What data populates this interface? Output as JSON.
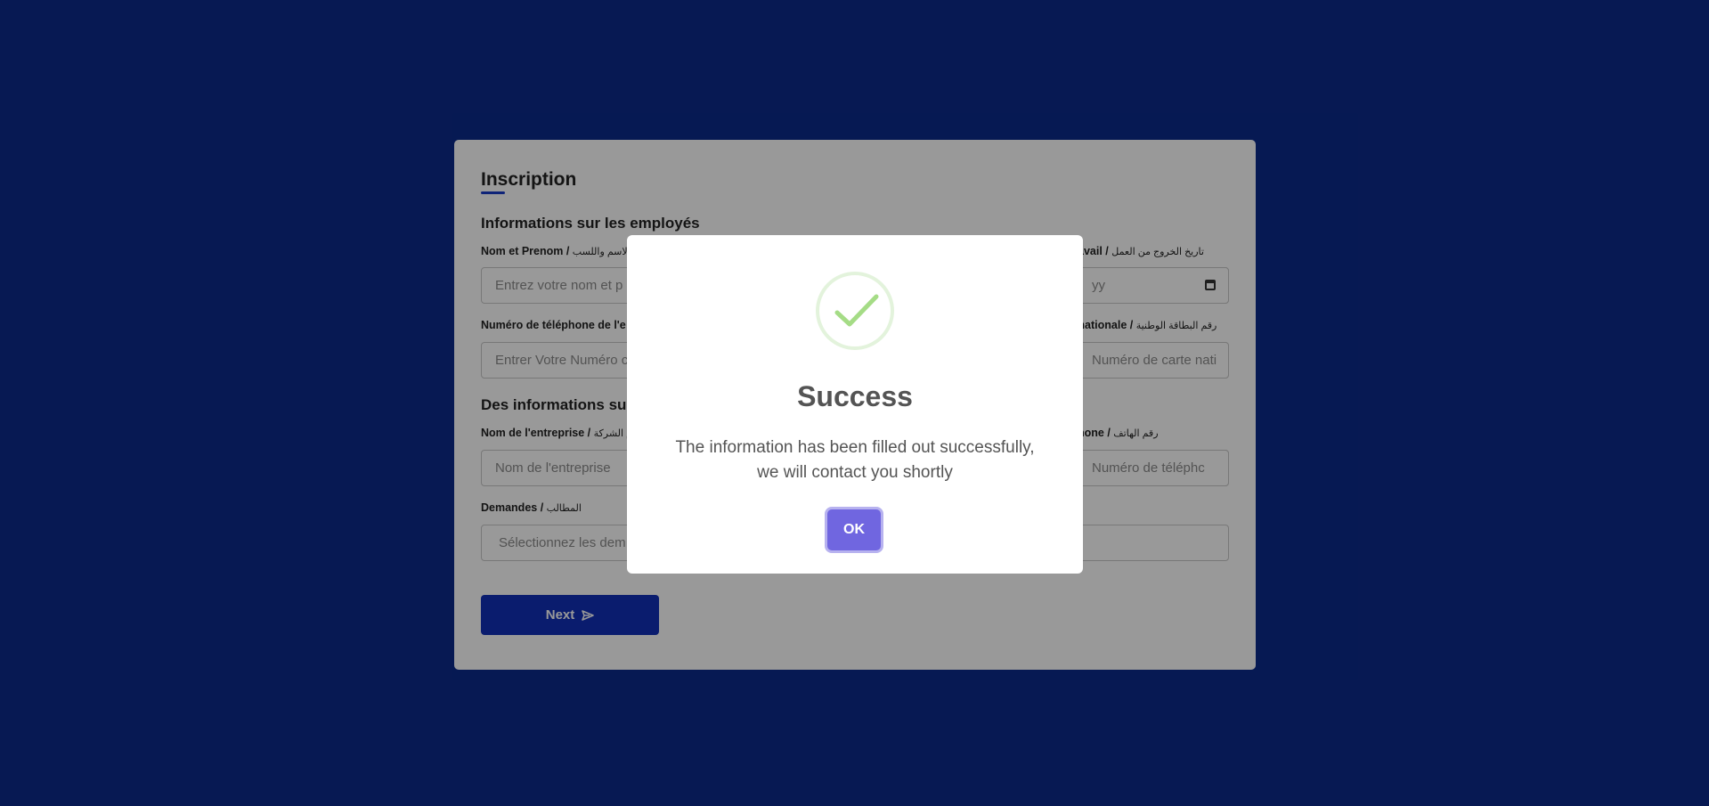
{
  "form": {
    "title": "Inscription",
    "section1_title": "Informations sur les employés",
    "section2_title": "Des informations sur",
    "fields": {
      "name_label": "Nom et Prenom / ",
      "name_label_ar": "الاسم واللسب",
      "name_placeholder": "Entrez votre nom et p",
      "exit_label": "avail / ",
      "exit_label_ar": "تاريخ الخروج من العمل",
      "exit_value": "yy",
      "phone_label": "Numéro de téléphone de l'e",
      "phone_placeholder": "Entrer Votre Numéro c",
      "id_label": "e nationale / ",
      "id_label_ar": "رقم البطاقة الوطنية",
      "id_placeholder": "Numéro de carte nati",
      "company_label": "Nom de l'entreprise / ",
      "company_label_ar": "م الشركة",
      "company_placeholder": "Nom de l'entreprise",
      "company_phone_label": "hone / ",
      "company_phone_label_ar": "رقم الهاتف",
      "company_phone_placeholder": "Numéro de téléphc",
      "demandes_label": "Demandes / ",
      "demandes_label_ar": "المطالب",
      "demandes_placeholder": "Sélectionnez les dem"
    },
    "next_label": "Next",
    "next_icon": "send-icon"
  },
  "modal": {
    "icon": "success-check-icon",
    "title": "Success",
    "text_line1": "The information has been filled out successfully,",
    "text_line2": "we will contact you shortly",
    "ok_label": "OK"
  },
  "colors": {
    "background": "#0b2a8a",
    "primary": "#1230b8",
    "ok_button": "#7066e0",
    "check_green": "#a5dc86"
  }
}
